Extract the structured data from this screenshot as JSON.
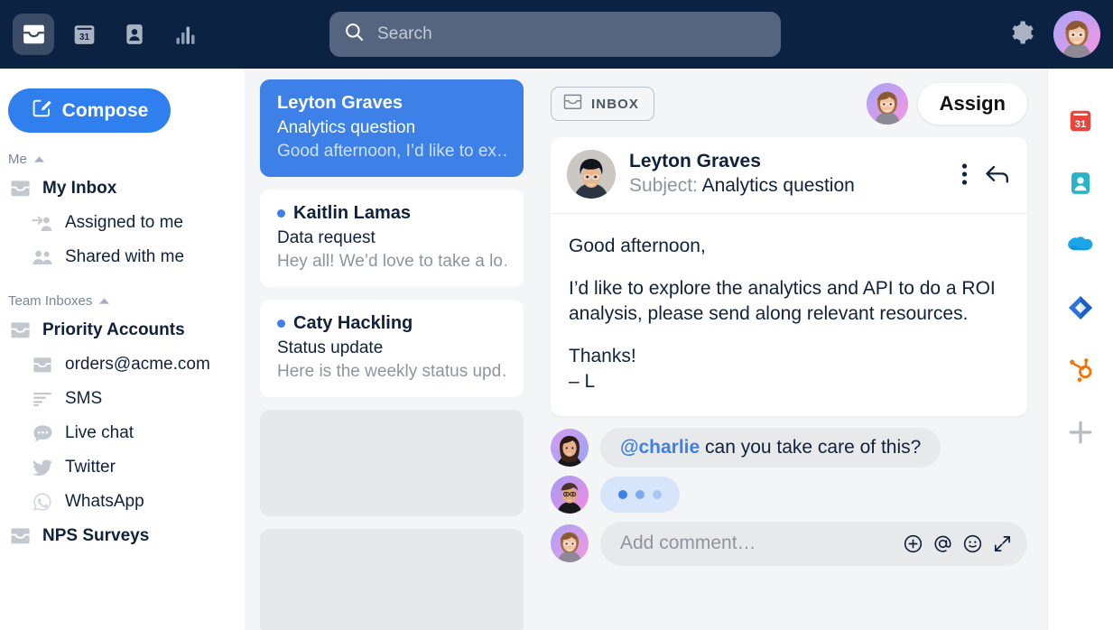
{
  "topbar": {
    "nav": [
      {
        "name": "inbox",
        "label": "Inbox",
        "icon": "inbox-icon",
        "active": true
      },
      {
        "name": "calendar",
        "label": "Calendar",
        "icon": "calendar-31-icon",
        "active": false
      },
      {
        "name": "contacts",
        "label": "Contacts",
        "icon": "contact-card-icon",
        "active": false
      },
      {
        "name": "analytics",
        "label": "Analytics",
        "icon": "bar-chart-icon",
        "active": false
      }
    ],
    "search": {
      "placeholder": "Search",
      "value": ""
    },
    "settings_label": "Settings",
    "account_label": "Account",
    "background": "#0B2242",
    "active_pill": "#3A4C66"
  },
  "sidebar": {
    "compose_label": "Compose",
    "sections": [
      {
        "title": "Me",
        "items": [
          {
            "label": "My Inbox",
            "icon": "inbox-icon",
            "bold": true,
            "indent": false
          },
          {
            "label": "Assigned to me",
            "icon": "assigned-arrow-icon",
            "bold": false,
            "indent": true
          },
          {
            "label": "Shared with me",
            "icon": "people-icon",
            "bold": false,
            "indent": true
          }
        ]
      },
      {
        "title": "Team Inboxes",
        "items": [
          {
            "label": "Priority Accounts",
            "icon": "inbox-icon",
            "bold": true,
            "indent": false
          },
          {
            "label": "orders@acme.com",
            "icon": "inbox-icon",
            "bold": false,
            "indent": true
          },
          {
            "label": "SMS",
            "icon": "sms-icon",
            "bold": false,
            "indent": true
          },
          {
            "label": "Live chat",
            "icon": "chat-bubble-icon",
            "bold": false,
            "indent": true
          },
          {
            "label": "Twitter",
            "icon": "twitter-icon",
            "bold": false,
            "indent": true
          },
          {
            "label": "WhatsApp",
            "icon": "whatsapp-icon",
            "bold": false,
            "indent": true
          },
          {
            "label": "NPS Surveys",
            "icon": "inbox-icon",
            "bold": true,
            "indent": false
          }
        ]
      }
    ]
  },
  "conversation_list": [
    {
      "name": "Leyton Graves",
      "subject": "Analytics question",
      "preview": "Good afternoon, I’d like to ex…",
      "selected": true,
      "unread": false
    },
    {
      "name": "Kaitlin Lamas",
      "subject": "Data request",
      "preview": "Hey all! We’d love to take a lo…",
      "selected": false,
      "unread": true
    },
    {
      "name": "Caty Hackling",
      "subject": "Status update",
      "preview": "Here is the weekly status upd…",
      "selected": false,
      "unread": true
    }
  ],
  "conversation_list_placeholders": 2,
  "thread": {
    "inbox_pill_label": "INBOX",
    "assign_label": "Assign",
    "message": {
      "from": "Leyton Graves",
      "subject_prefix": "Subject: ",
      "subject": "Analytics question",
      "paragraphs": [
        "Good afternoon,",
        "I’d like to explore the analytics and API to do a ROI analysis, please send along relevant resources.",
        "Thanks!\n– L"
      ],
      "more_label": "More actions",
      "reply_label": "Reply"
    },
    "comments": [
      {
        "type": "text",
        "mention": "@charlie",
        "text": " can you take care of this?"
      },
      {
        "type": "typing"
      }
    ],
    "composer": {
      "placeholder": "Add comment…",
      "value": "",
      "actions": [
        {
          "name": "add-attachment-icon",
          "label": "Add"
        },
        {
          "name": "mention-icon",
          "label": "Mention"
        },
        {
          "name": "emoji-icon",
          "label": "Emoji"
        },
        {
          "name": "expand-icon",
          "label": "Expand"
        }
      ]
    }
  },
  "right_rail": [
    {
      "name": "calendar-app",
      "label": "Calendar",
      "icon": "calendar-31-icon",
      "color": "#E8463C"
    },
    {
      "name": "contacts-app",
      "label": "Contacts",
      "icon": "contact-card-icon",
      "color": "#29B5C8"
    },
    {
      "name": "salesforce-app",
      "label": "Salesforce",
      "icon": "cloud-icon",
      "color": "#1AA7E8"
    },
    {
      "name": "jira-app",
      "label": "Jira",
      "icon": "diamond-icon",
      "color": "#2D74DB"
    },
    {
      "name": "hubspot-app",
      "label": "HubSpot",
      "icon": "sprocket-icon",
      "color": "#F2750A"
    },
    {
      "name": "add-app",
      "label": "Add app",
      "icon": "plus-icon",
      "color": "#B6BAC1"
    }
  ],
  "colors": {
    "brand_blue": "#3C80E8",
    "navy": "#0B2242",
    "panel_gray": "#F4F5F7",
    "text_dark": "#10213C",
    "text_muted": "#8E949F"
  }
}
